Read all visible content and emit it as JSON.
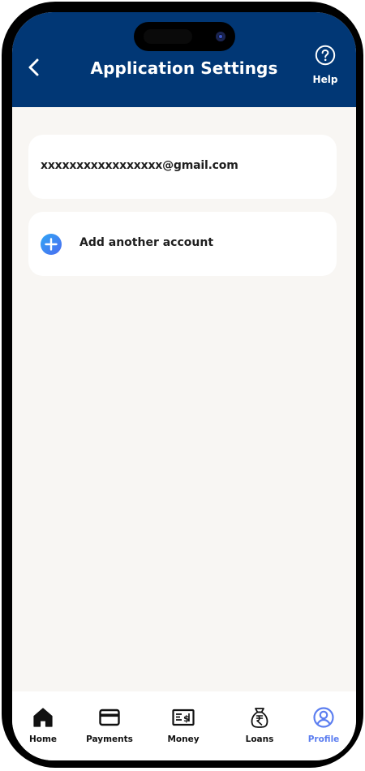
{
  "header": {
    "title": "Application Settings",
    "help_label": "Help",
    "background_color": "#013775"
  },
  "account": {
    "email": "xxxxxxxxxxxxxxxxx@gmail.com"
  },
  "add_account": {
    "label": "Add another account"
  },
  "tab_bar": {
    "active_color": "#5c7ef0",
    "tabs": [
      {
        "label": "Home",
        "icon": "home-icon",
        "active": false
      },
      {
        "label": "Payments",
        "icon": "card-icon",
        "active": false
      },
      {
        "label": "Money",
        "icon": "money-icon",
        "active": false
      },
      {
        "label": "Loans",
        "icon": "rupee-bag-icon",
        "active": false
      },
      {
        "label": "Profile",
        "icon": "profile-icon",
        "active": true
      }
    ]
  }
}
